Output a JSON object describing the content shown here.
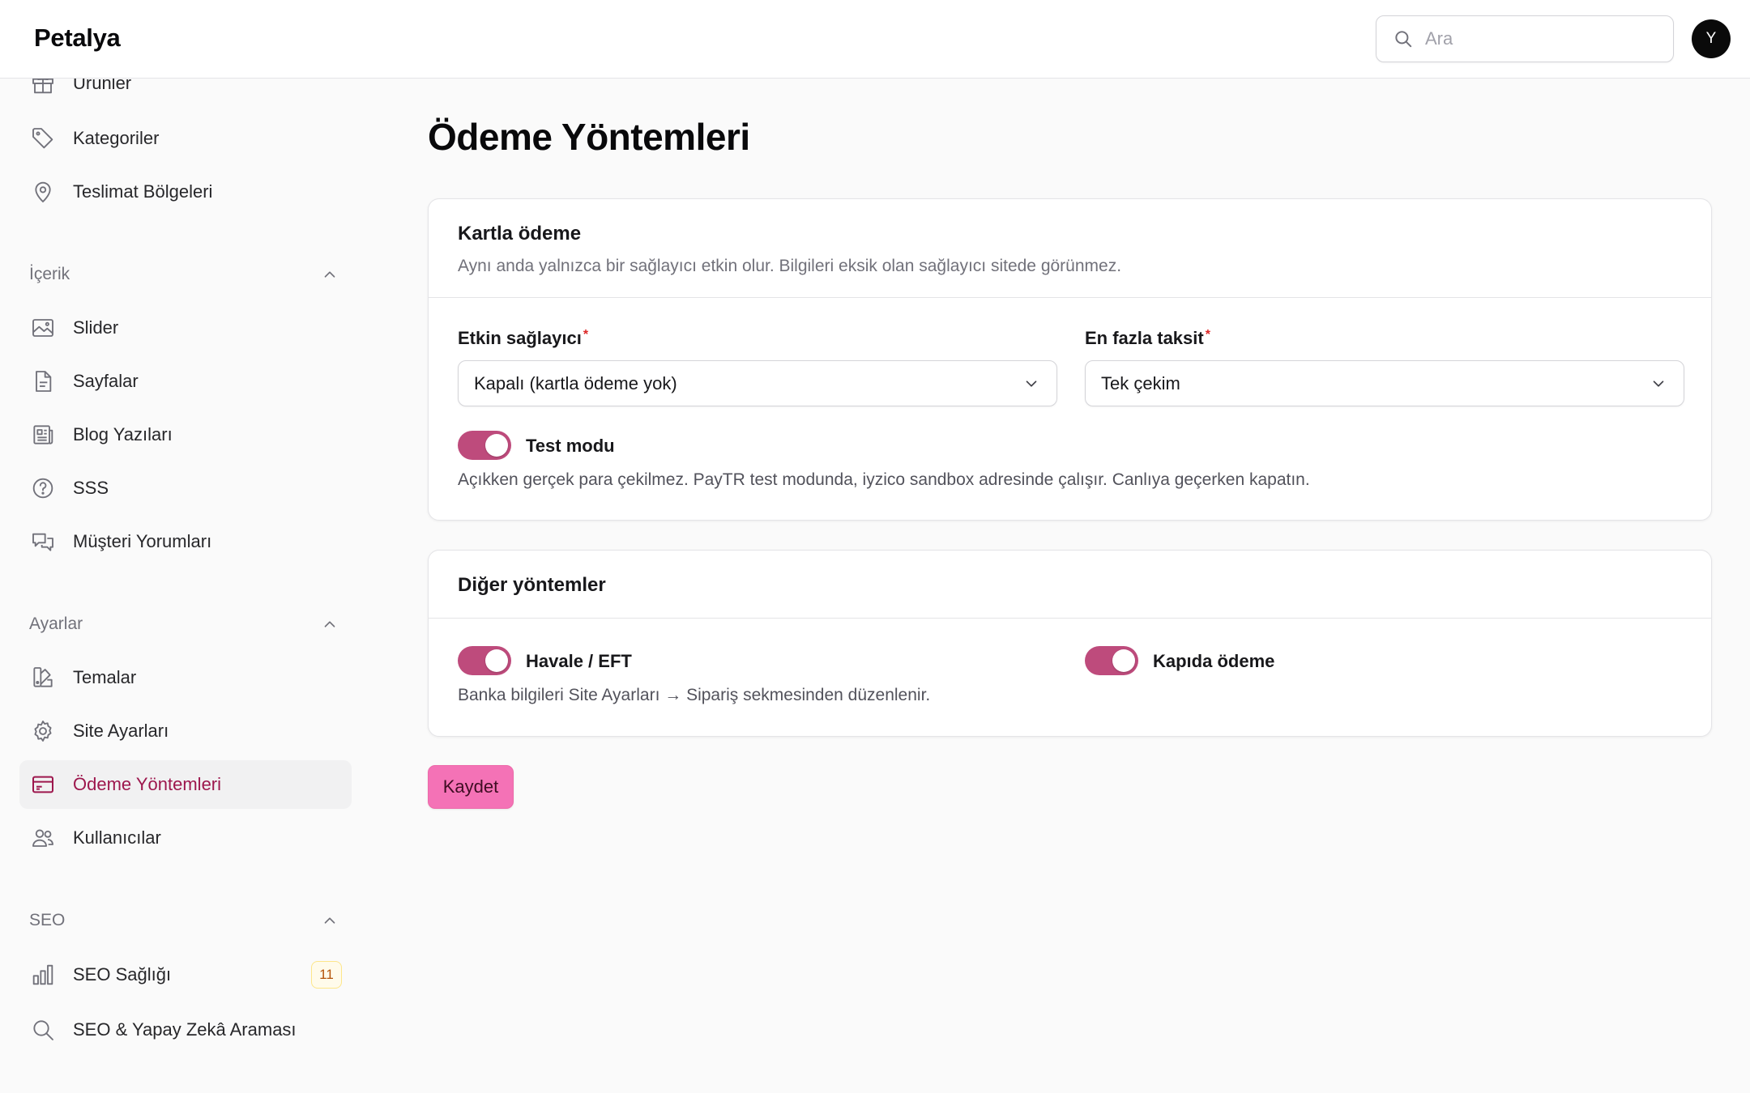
{
  "app": {
    "brand": "Petalya"
  },
  "header": {
    "search_placeholder": "Ara",
    "avatar_initial": "Y"
  },
  "sidebar": {
    "catalog_items": [
      {
        "label": "Ürünler",
        "icon": "gift-icon"
      },
      {
        "label": "Kategoriler",
        "icon": "tag-icon"
      },
      {
        "label": "Teslimat Bölgeleri",
        "icon": "map-pin-icon"
      }
    ],
    "groups": {
      "content": "İçerik",
      "settings": "Ayarlar",
      "seo": "SEO"
    },
    "content_items": [
      {
        "label": "Slider",
        "icon": "image-icon"
      },
      {
        "label": "Sayfalar",
        "icon": "document-icon"
      },
      {
        "label": "Blog Yazıları",
        "icon": "newspaper-icon"
      },
      {
        "label": "SSS",
        "icon": "question-icon"
      },
      {
        "label": "Müşteri Yorumları",
        "icon": "chat-bubbles-icon"
      }
    ],
    "settings_items": [
      {
        "label": "Temalar",
        "icon": "swatch-icon"
      },
      {
        "label": "Site Ayarları",
        "icon": "gear-icon"
      },
      {
        "label": "Ödeme Yöntemleri",
        "icon": "credit-card-icon",
        "active": true
      },
      {
        "label": "Kullanıcılar",
        "icon": "users-icon"
      }
    ],
    "seo_items": [
      {
        "label": "SEO Sağlığı",
        "icon": "bar-chart-icon",
        "badge": "11"
      },
      {
        "label": "SEO & Yapay Zekâ Araması",
        "icon": "search-icon"
      }
    ]
  },
  "main": {
    "title": "Ödeme Yöntemleri",
    "card_payment": {
      "title": "Kartla ödeme",
      "description": "Aynı anda yalnızca bir sağlayıcı etkin olur. Bilgileri eksik olan sağlayıcı sitede görünmez.",
      "provider_label": "Etkin sağlayıcı",
      "provider_value": "Kapalı (kartla ödeme yok)",
      "installment_label": "En fazla taksit",
      "installment_value": "Tek çekim",
      "required_mark": "*",
      "test_mode_label": "Test modu",
      "test_mode_on": true,
      "test_mode_help": "Açıkken gerçek para çekilmez. PayTR test modunda, iyzico sandbox adresinde çalışır. Canlıya geçerken kapatın."
    },
    "card_other": {
      "title": "Diğer yöntemler",
      "transfer_label": "Havale / EFT",
      "transfer_on": true,
      "transfer_help": "Banka bilgileri Site Ayarları → Sipariş sekmesinden düzenlenir.",
      "cod_label": "Kapıda ödeme",
      "cod_on": true
    },
    "save_label": "Kaydet"
  },
  "colors": {
    "accent": "#be4b7c",
    "active_text": "#9d174d",
    "save_button": "#f472b6"
  }
}
